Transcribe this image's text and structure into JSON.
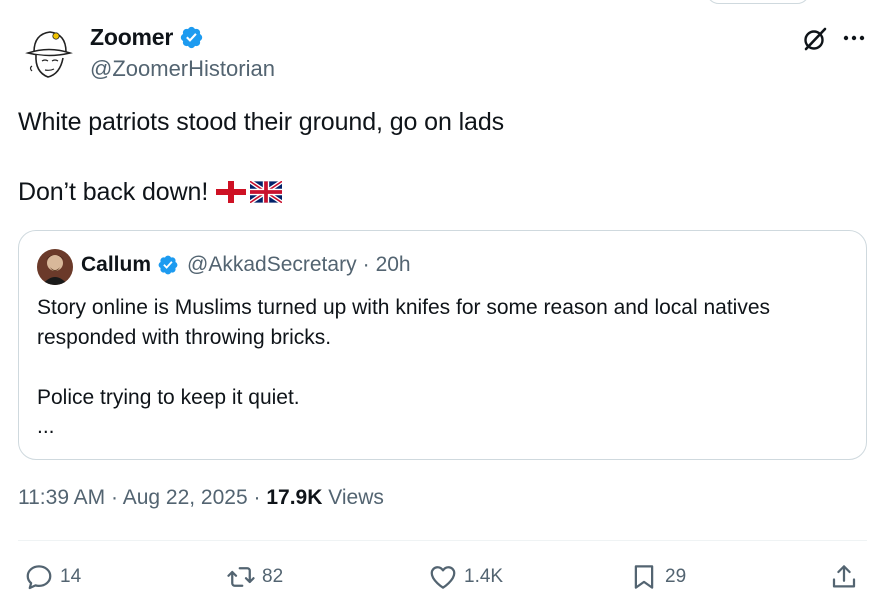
{
  "author": {
    "display_name": "Zoomer",
    "handle": "@ZoomerHistorian",
    "verified": true
  },
  "tweet": {
    "line1": "White patriots stood their ground, go on lads",
    "line2": "Don’t back down!",
    "flags": [
      "flag-england-icon",
      "flag-uk-icon"
    ]
  },
  "quoted": {
    "display_name": "Callum",
    "handle": "@AkkadSecretary",
    "separator": "·",
    "time": "20h",
    "line1": "Story online is Muslims turned up with knifes for some reason and local natives",
    "line2": "responded with throwing bricks.",
    "line3": "Police trying to keep it quiet.",
    "line4": "..."
  },
  "meta": {
    "time": "11:39 AM",
    "sep1": "·",
    "date": "Aug 22, 2025",
    "sep2": "·",
    "views_count": "17.9K",
    "views_label": "Views"
  },
  "actions": {
    "replies": "14",
    "reposts": "82",
    "likes": "1.4K",
    "bookmarks": "29"
  },
  "colors": {
    "verified": "#1d9bf0",
    "text": "#0f1419",
    "secondary": "#536471",
    "border": "#cfd9de"
  }
}
